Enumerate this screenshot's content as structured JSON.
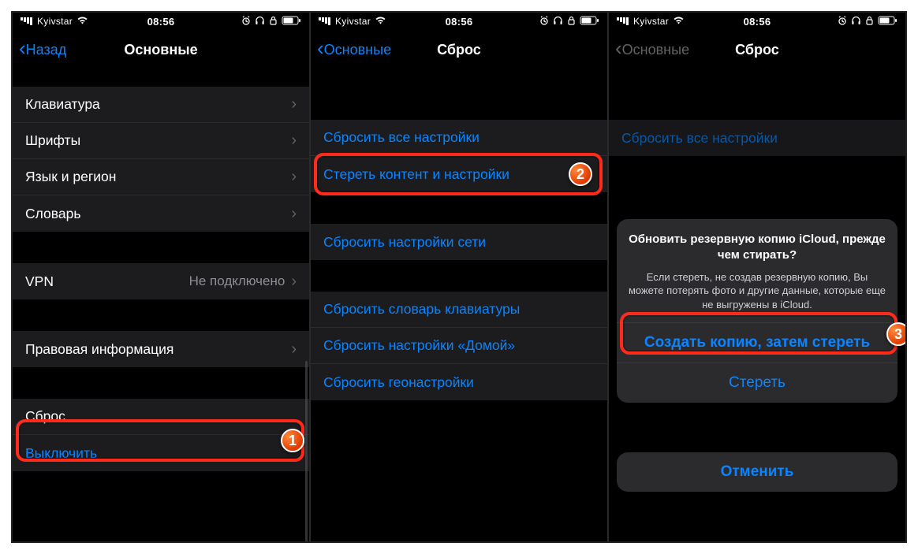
{
  "status": {
    "carrier": "Kyivstar",
    "time": "08:56"
  },
  "panel1": {
    "nav": {
      "back": "Назад",
      "title": "Основные"
    },
    "rows": {
      "keyboard": "Клавиатура",
      "fonts": "Шрифты",
      "lang": "Язык и регион",
      "dict": "Словарь",
      "vpn_label": "VPN",
      "vpn_value": "Не подключено",
      "legal": "Правовая информация",
      "reset": "Сброс",
      "shutdown": "Выключить"
    }
  },
  "panel2": {
    "nav": {
      "back": "Основные",
      "title": "Сброс"
    },
    "rows": {
      "reset_all": "Сбросить все настройки",
      "erase": "Стереть контент и настройки",
      "reset_net": "Сбросить настройки сети",
      "reset_kb": "Сбросить словарь клавиатуры",
      "reset_home": "Сбросить настройки «Домой»",
      "reset_geo": "Сбросить геонастройки"
    }
  },
  "panel3": {
    "nav": {
      "back": "Основные",
      "title": "Сброс"
    },
    "rows": {
      "reset_all": "Сбросить все настройки"
    },
    "sheet": {
      "title": "Обновить резервную копию iCloud, прежде чем стирать?",
      "desc": "Если стереть, не создав резервную копию, Вы можете потерять фото и другие данные, которые еще не выгружены в iCloud.",
      "backup_erase": "Создать копию, затем стереть",
      "erase": "Стереть",
      "cancel": "Отменить"
    }
  },
  "badges": {
    "b1": "1",
    "b2": "2",
    "b3": "3"
  }
}
